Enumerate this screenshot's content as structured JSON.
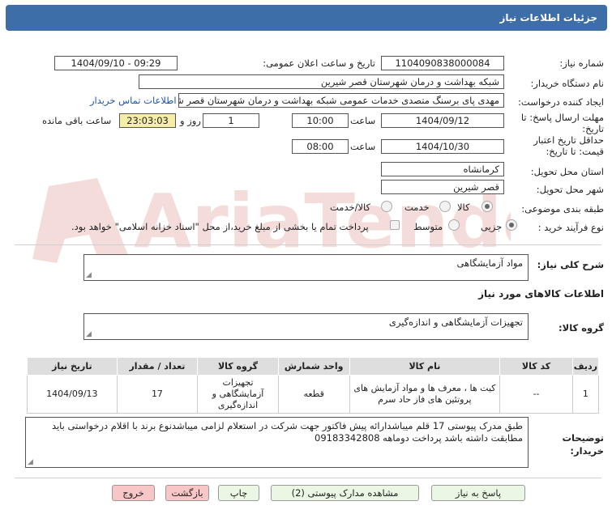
{
  "header": {
    "title": "جزئیات اطلاعات نیاز"
  },
  "form": {
    "need_number_label": "شماره نیاز:",
    "need_number": "1104090838000084",
    "announce_label": "تاریخ و ساعت اعلان عمومی:",
    "announce_value": "1404/09/10 - 09:29",
    "buyer_org_label": "نام دستگاه خریدار:",
    "buyer_org": "شبکه بهداشت و درمان شهرستان قصر شیرین",
    "creator_label": "ایجاد کننده درخواست:",
    "creator": "مهدی پای برسنگ متصدی خدمات عمومی شبکه بهداشت و درمان شهرستان قصر شیرین",
    "contact_link": "اطلاعات تماس خریدار",
    "reply_deadline_label": "مهلت ارسال پاسخ: تا تاریخ:",
    "reply_date": "1404/09/12",
    "time_label": "ساعت",
    "reply_time": "10:00",
    "days_value": "1",
    "days_label": "روز و",
    "remaining_time": "23:03:03",
    "remaining_label": "ساعت باقی مانده",
    "validity_label": "حداقل تاریخ اعتبار قیمت: تا تاریخ:",
    "validity_date": "1404/10/30",
    "validity_time": "08:00",
    "province_label": "استان محل تحویل:",
    "province": "کرمانشاه",
    "city_label": "شهر محل تحویل:",
    "city": "قصر شیرین",
    "category_label": "طبقه بندی موضوعی:",
    "category_options": [
      "کالا",
      "خدمت",
      "کالا/خدمت"
    ],
    "category_selected": "کالا",
    "process_label": "نوع فرآیند خرید :",
    "process_options": [
      "جزیی",
      "متوسط"
    ],
    "process_selected": "جزیی",
    "payment_note": "پرداخت تمام یا بخشی از مبلغ خرید،از محل \"اسناد خزانه اسلامی\" خواهد بود."
  },
  "summary": {
    "label": "شرح کلی نیاز:",
    "value": "مواد آزمایشگاهی"
  },
  "goods_info": {
    "title": "اطلاعات کالاهای مورد نیاز"
  },
  "goods_group": {
    "label": "گروه کالا:",
    "value": "تجهیزات آزمایشگاهی و اندازه‌گیری"
  },
  "table": {
    "headers": [
      "ردیف",
      "کد کالا",
      "نام کالا",
      "واحد شمارش",
      "گروه کالا",
      "تعداد / مقدار",
      "تاریخ نیاز"
    ],
    "rows": [
      {
        "row": "1",
        "code": "--",
        "name": "کیت ها ، معرف ها و مواد آزمایش های پروتئین های فاز حاد سرم",
        "unit": "قطعه",
        "group": "تجهیزات آزمایشگاهی و اندازه‌گیری",
        "qty": "17",
        "date": "1404/09/13"
      }
    ]
  },
  "buyer_notes": {
    "label": "توضیحات خریدار:",
    "value": "طبق مدرک پیوستی  17 قلم میباشدارائه پیش فاکتور جهت شرکت در استعلام لزامی میباشدنوع برند با اقلام درخواستی باید مطابقت داشته باشد پرداخت دوماهه 09183342808"
  },
  "buttons": {
    "reply": "پاسخ به نیاز",
    "view_docs": "مشاهده مدارک پیوستی (2)",
    "print": "چاپ",
    "back": "بازگشت",
    "exit": "خروج"
  },
  "watermark": {
    "text": "AriaTender.net"
  },
  "colors": {
    "header": "#3d6ea8",
    "highlight": "#f6eea7",
    "button_green": "#eaf7e4",
    "button_red": "#f8c6c6",
    "link": "#1d55b5"
  }
}
